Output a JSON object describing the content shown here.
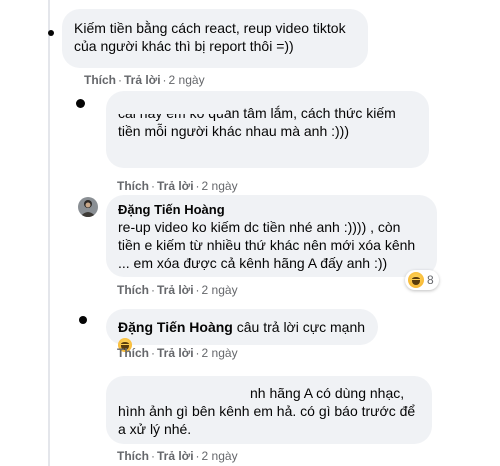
{
  "comments": [
    {
      "text": "Kiếm tiền bằng cách react, reup video tiktok của người khác thì bị report thôi =))",
      "meta": {
        "like": "Thích",
        "reply": "Trả lời",
        "time": "2 ngày"
      }
    },
    {
      "text": "cái này em ko quan tâm lắm, cách thức kiếm tiền mỗi người khác nhau mà anh :)))",
      "meta": {
        "like": "Thích",
        "reply": "Trả lời",
        "time": "2 ngày"
      }
    },
    {
      "author": "Đặng Tiến Hoàng",
      "text": "re-up video ko kiếm dc tiền nhé anh :)))) , còn tiền e kiếm từ nhiều thứ khác nên mới xóa kênh ... em xóa được cả kênh hãng A đấy anh :))",
      "reaction_count": "8",
      "meta": {
        "like": "Thích",
        "reply": "Trả lời",
        "time": "2 ngày"
      }
    },
    {
      "author": "Đặng Tiến Hoàng",
      "text": "câu trả lời cực mạnh",
      "meta": {
        "like": "Thích",
        "reply": "Trả lời",
        "time": "2 ngày"
      }
    },
    {
      "text": "nh hãng A có dùng nhạc, hình ảnh gì bên kênh em hả. có gì báo trước để a xử lý nhé.",
      "meta": {
        "like": "Thích",
        "reply": "Trả lời",
        "time": "2 ngày"
      }
    }
  ]
}
